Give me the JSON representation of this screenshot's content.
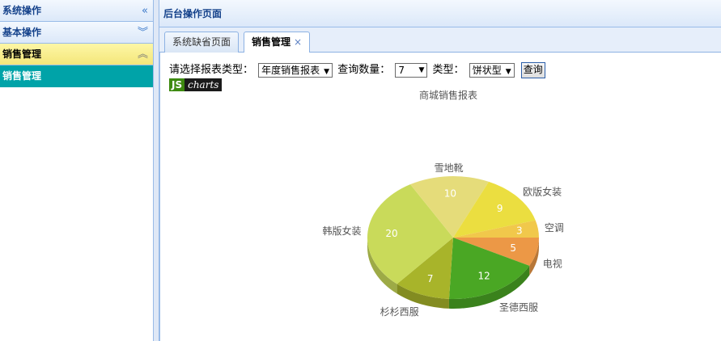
{
  "sidebar": {
    "sections": [
      {
        "title": "系统操作",
        "icon": "double-chevron-left-icon"
      },
      {
        "title": "基本操作",
        "icon": "double-chevron-down-icon"
      },
      {
        "title": "销售管理",
        "icon": "double-chevron-up-icon"
      }
    ],
    "active_item": "销售管理"
  },
  "main": {
    "title": "后台操作页面",
    "tabs": [
      {
        "label": "系统缺省页面",
        "active": false
      },
      {
        "label": "销售管理",
        "active": true,
        "close": "×"
      }
    ]
  },
  "query": {
    "report_type_label": "请选择报表类型：",
    "report_type_value": "年度销售报表",
    "count_label": "查询数量：",
    "count_value": "7",
    "chart_type_label": "类型：",
    "chart_type_value": "饼状型",
    "submit_label": "查询"
  },
  "logo": {
    "js": "JS",
    "charts": "charts"
  },
  "colors": {
    "accent": "#99bbe8",
    "active_item_bg": "#00a3a8",
    "active_header_bg": "#f4e67a"
  },
  "chart_data": {
    "type": "pie",
    "title": "商城销售报表",
    "categories": [
      "电视",
      "圣德西服",
      "杉杉西服",
      "韩版女装",
      "雪地靴",
      "欧版女装",
      "空调"
    ],
    "values": [
      5,
      12,
      7,
      20,
      10,
      9,
      3
    ],
    "colors": [
      "#ec9846",
      "#4aa724",
      "#a8b42a",
      "#c9da5a",
      "#e5dc7a",
      "#ebde40",
      "#f1c84b"
    ]
  }
}
